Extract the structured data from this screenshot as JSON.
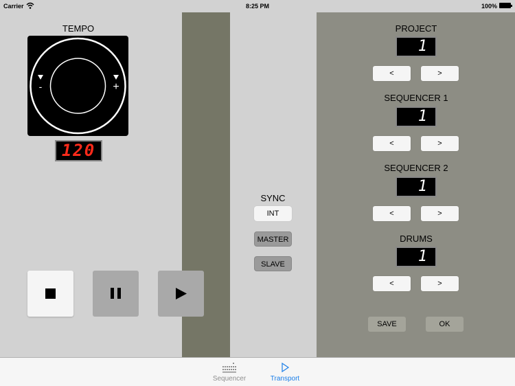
{
  "status_bar": {
    "carrier": "Carrier",
    "time": "8:25 PM",
    "battery": "100%"
  },
  "tempo": {
    "label": "TEMPO",
    "minus": "-",
    "plus": "+",
    "value": "120"
  },
  "transport": {
    "stop_icon": "stop-icon",
    "pause_icon": "pause-icon",
    "play_icon": "play-icon"
  },
  "sync": {
    "label": "SYNC",
    "options": [
      "INT",
      "MASTER",
      "SLAVE"
    ],
    "selected": "INT"
  },
  "sections": [
    {
      "label": "PROJECT",
      "value": "1",
      "prev": "<",
      "next": ">"
    },
    {
      "label": "SEQUENCER 1",
      "value": "1",
      "prev": "<",
      "next": ">"
    },
    {
      "label": "SEQUENCER 2",
      "value": "1",
      "prev": "<",
      "next": ">"
    },
    {
      "label": "DRUMS",
      "value": "1",
      "prev": "<",
      "next": ">"
    }
  ],
  "actions": {
    "save": "SAVE",
    "ok": "OK"
  },
  "tabs": [
    {
      "label": "Sequencer",
      "icon": "keyboard-icon",
      "active": false
    },
    {
      "label": "Transport",
      "icon": "play-triangle-icon",
      "active": true
    }
  ],
  "colors": {
    "accent": "#1a7ee8",
    "led_red": "#ff2a1a"
  }
}
